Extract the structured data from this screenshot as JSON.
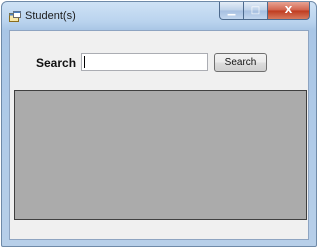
{
  "window": {
    "title": "Student(s)",
    "minimize_glyph": "▁",
    "maximize_glyph": "□",
    "close_glyph": "X"
  },
  "search": {
    "label": "Search",
    "input_value": "",
    "button_label": "Search"
  },
  "icons": {
    "app": "app-window-icon",
    "minimize": "minimize-icon",
    "maximize": "maximize-icon",
    "close": "close-icon"
  },
  "colors": {
    "grid_background": "#ababab",
    "client_background": "#f0f0f0",
    "close_button": "#c74a2f"
  }
}
